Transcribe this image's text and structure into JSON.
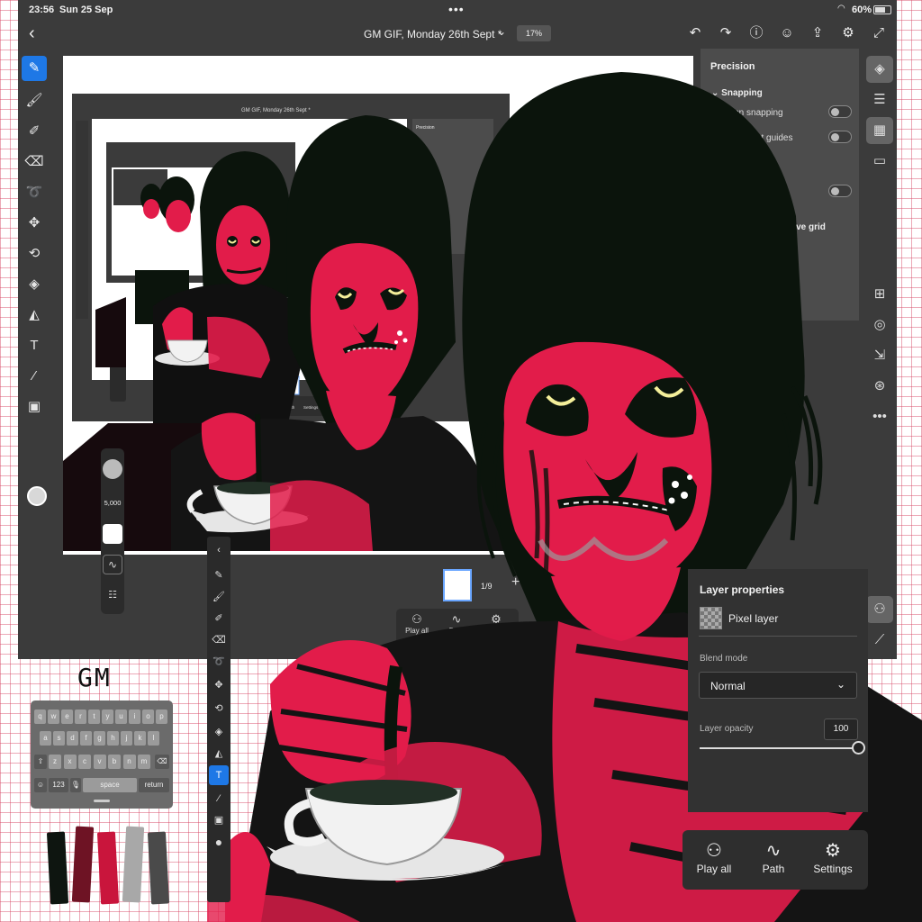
{
  "status_bar": {
    "time": "23:56",
    "date": "Sun 25 Sep",
    "battery": "60%"
  },
  "top_bar": {
    "document_title": "GM GIF, Monday 26th Sept *",
    "zoom": "17%"
  },
  "precision_panel": {
    "title": "Precision",
    "snapping_heading": "Snapping",
    "rotation_snapping": "Rotation snapping",
    "alignment_guides_partial": "ment guides",
    "perspective_grid_partial": "tive grid"
  },
  "animation": {
    "frame_counter": "1/9"
  },
  "mini_actions": {
    "play_all": "Play all",
    "path": "Path",
    "settings": "Settings"
  },
  "brush": {
    "size": "5,000"
  },
  "handwritten_text": "GM",
  "keyboard": {
    "row1": [
      "q",
      "w",
      "e",
      "r",
      "t",
      "y",
      "u",
      "i",
      "o",
      "p"
    ],
    "row2": [
      "a",
      "s",
      "d",
      "f",
      "g",
      "h",
      "j",
      "k",
      "l"
    ],
    "row3": [
      "z",
      "x",
      "c",
      "v",
      "b",
      "n",
      "m"
    ],
    "numbers_key": "123",
    "space_key": "space",
    "return_key": "return"
  },
  "palette": [
    "#0e1510",
    "#6e1324",
    "#c9153c",
    "#a8a8a8",
    "#4a4a4a"
  ],
  "layer_properties": {
    "title": "Layer properties",
    "layer_name": "Pixel layer",
    "blend_mode_label": "Blend mode",
    "blend_mode": "Normal",
    "opacity_label": "Layer opacity",
    "opacity": "100",
    "opacity_value": 1.0
  },
  "bottom_bar": {
    "play_all": "Play all",
    "path": "Path",
    "settings": "Settings"
  },
  "colors": {
    "accent": "#1e78e6",
    "ui_dark": "#2e2e2e",
    "ui_mid": "#3b3b3b",
    "skin": "#e21c4a",
    "hair": "#0b140c"
  }
}
